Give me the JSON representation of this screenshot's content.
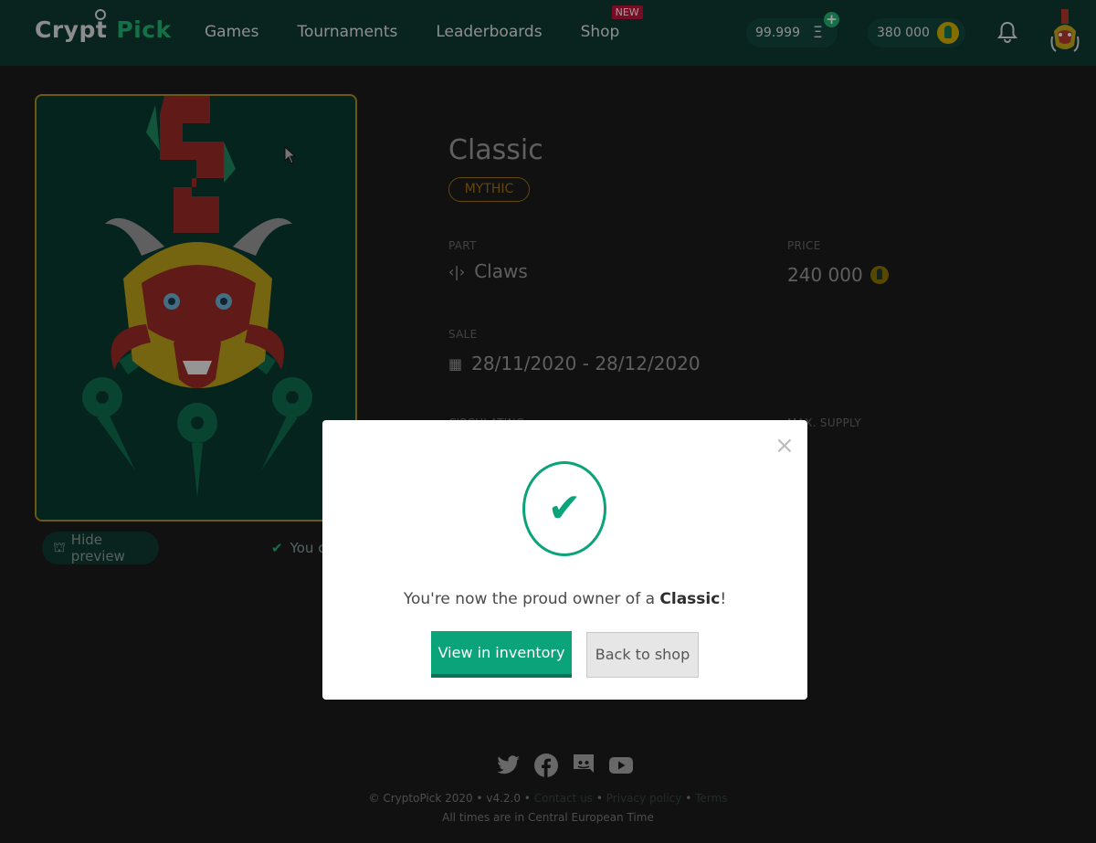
{
  "header": {
    "logo_part1": "Crypt",
    "logo_part2": "Pick",
    "nav": [
      "Games",
      "Tournaments",
      "Leaderboards",
      "Shop"
    ],
    "shop_badge": "NEW",
    "eth_balance": "99.999",
    "eth_symbol": "Ξ",
    "plus": "+",
    "coin_balance": "380 000",
    "icons": {
      "bell": "bell-icon",
      "avatar": "dragon-avatar"
    }
  },
  "card": {
    "hide_preview_icon": "⛫",
    "hide_preview": "Hide preview",
    "owned_check": "✔",
    "owned_text": "You o"
  },
  "item": {
    "title": "Classic",
    "rarity": "MYTHIC",
    "part_label": "PART",
    "part_icon": "‹|›",
    "part_value": "Claws",
    "price_label": "PRICE",
    "price_value": "240 000",
    "sale_label": "SALE",
    "sale_icon": "▦",
    "sale_value": "28/11/2020 - 28/12/2020",
    "circulating_label": "CIRCULATING",
    "max_supply_label": "MAX. SUPPLY"
  },
  "modal": {
    "close": "×",
    "check": "✔",
    "message_prefix": "You're now the proud owner of a ",
    "message_item": "Classic",
    "message_suffix": "!",
    "primary_button": "View in inventory",
    "secondary_button": "Back to shop"
  },
  "footer": {
    "socials": [
      "twitter",
      "facebook",
      "discord",
      "youtube"
    ],
    "copyright": "© CryptoPick 2020 • v4.2.0 • ",
    "contact": "Contact us",
    "sep": " • ",
    "privacy": "Privacy policy",
    "terms": "Terms",
    "timezone": "All times are in Central European Time"
  },
  "colors": {
    "accent": "#0aa37a",
    "header_bg": "#0f3a33",
    "page_bg": "#1c1c1c",
    "rarity": "#a27312",
    "card_border": "#b38d27"
  }
}
